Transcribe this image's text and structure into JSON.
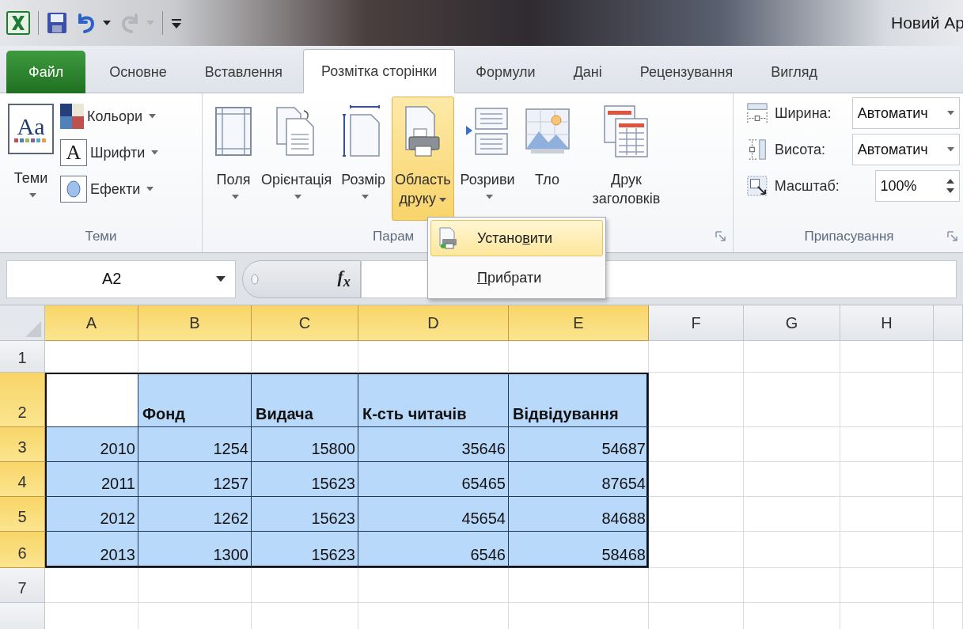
{
  "title_bar": {
    "title": "Новий Ар",
    "quick_access": [
      {
        "kind": "save",
        "has_menu": false
      },
      {
        "kind": "undo",
        "disabled": false,
        "has_menu": true
      },
      {
        "kind": "redo",
        "disabled": true,
        "has_menu": true
      },
      {
        "kind": "customize",
        "has_menu": false
      }
    ]
  },
  "tabs": [
    {
      "label": "Файл",
      "kind": "file",
      "selected": false
    },
    {
      "label": "Основне",
      "kind": "tab",
      "selected": false
    },
    {
      "label": "Вставлення",
      "kind": "tab",
      "selected": false
    },
    {
      "label": "Розмітка сторінки",
      "kind": "tab",
      "selected": true
    },
    {
      "label": "Формули",
      "kind": "tab",
      "selected": false
    },
    {
      "label": "Дані",
      "kind": "tab",
      "selected": false
    },
    {
      "label": "Рецензування",
      "kind": "tab",
      "selected": false
    },
    {
      "label": "Вигляд",
      "kind": "tab",
      "selected": false
    }
  ],
  "ribbon": {
    "themes_group": {
      "label": "Теми",
      "themes_button": {
        "label": "Теми",
        "icon_text": "Aa",
        "has_menu": true
      },
      "items": [
        {
          "label": "Кольори",
          "kind": "colors",
          "has_menu": true
        },
        {
          "label": "Шрифти",
          "kind": "fonts",
          "icon_text": "A",
          "has_menu": true
        },
        {
          "label": "Ефекти",
          "kind": "effects",
          "has_menu": true
        }
      ]
    },
    "page_setup_group": {
      "label": "Парам",
      "launcher": true,
      "buttons": [
        {
          "label": "Поля",
          "kind": "margins",
          "has_menu": true,
          "selected": false,
          "caret_inline": false
        },
        {
          "label": "Орієнтація",
          "kind": "orientation",
          "has_menu": true,
          "selected": false,
          "caret_inline": false
        },
        {
          "label": "Розмір",
          "kind": "size",
          "has_menu": true,
          "selected": false,
          "caret_inline": false
        },
        {
          "label": "Область\nдруку",
          "kind": "print_area",
          "has_menu": true,
          "selected": true,
          "caret_inline": true
        },
        {
          "label": "Розриви",
          "kind": "breaks",
          "has_menu": true,
          "selected": false,
          "caret_inline": false
        },
        {
          "label": "Тло",
          "kind": "background",
          "has_menu": false,
          "selected": false
        },
        {
          "label": "Друк\nзаголовків",
          "kind": "print_titles",
          "has_menu": false,
          "selected": false
        }
      ]
    },
    "fit_group": {
      "label": "Припасування",
      "launcher": true,
      "rows": [
        {
          "kind": "dropdown",
          "label": "Ширина:",
          "value": "Автоматич"
        },
        {
          "kind": "dropdown",
          "label": "Висота:",
          "value": "Автоматич"
        },
        {
          "kind": "spinner",
          "label": "Масштаб:",
          "value": "100%"
        }
      ]
    }
  },
  "formula_bar": {
    "name_box": "A2",
    "function_label": "f$_{x}$"
  },
  "menu": {
    "items": [
      {
        "has_icon": true,
        "selected": true,
        "parts": [
          {
            "text": "Устано",
            "underlined": false
          },
          {
            "text": "в",
            "underlined": true
          },
          {
            "text": "ити",
            "underlined": false
          }
        ]
      },
      {
        "has_icon": false,
        "selected": false,
        "parts": [
          {
            "text": "П",
            "underlined": true
          },
          {
            "text": "рибрати",
            "underlined": false
          }
        ]
      }
    ]
  },
  "sheet": {
    "columns": [
      {
        "label": "A",
        "selected": true
      },
      {
        "label": "B",
        "selected": true
      },
      {
        "label": "C",
        "selected": true
      },
      {
        "label": "D",
        "selected": true
      },
      {
        "label": "E",
        "selected": true
      },
      {
        "label": "F",
        "selected": false
      },
      {
        "label": "G",
        "selected": false
      },
      {
        "label": "H",
        "selected": false
      }
    ],
    "rows": [
      {
        "label": "1",
        "selected": false,
        "kind": "data"
      },
      {
        "label": "2",
        "selected": true,
        "kind": "header",
        "cells": [
          {
            "active": true
          },
          {
            "text": "Фонд",
            "active": false
          },
          {
            "text": "Видача",
            "active": false
          },
          {
            "text": "К-сть читачів",
            "active": false
          },
          {
            "text": "Відвідування",
            "active": false
          }
        ]
      },
      {
        "label": "3",
        "selected": true,
        "kind": "data",
        "cells": [
          {
            "text": "2010",
            "active": false
          },
          {
            "text": "1254",
            "active": false
          },
          {
            "text": "15800",
            "active": false
          },
          {
            "text": "35646",
            "active": false
          },
          {
            "text": "54687",
            "active": false
          }
        ]
      },
      {
        "label": "4",
        "selected": true,
        "kind": "data",
        "cells": [
          {
            "text": "2011",
            "active": false
          },
          {
            "text": "1257",
            "active": false
          },
          {
            "text": "15623",
            "active": false
          },
          {
            "text": "65465",
            "active": false
          },
          {
            "text": "87654",
            "active": false
          }
        ]
      },
      {
        "label": "5",
        "selected": true,
        "kind": "data",
        "cells": [
          {
            "text": "2012",
            "active": false
          },
          {
            "text": "1262",
            "active": false
          },
          {
            "text": "15623",
            "active": false
          },
          {
            "text": "45654",
            "active": false
          },
          {
            "text": "84688",
            "active": false
          }
        ]
      },
      {
        "label": "6",
        "selected": true,
        "kind": "data",
        "cells": [
          {
            "text": "2013",
            "active": false
          },
          {
            "text": "1300",
            "active": false
          },
          {
            "text": "15623",
            "active": false
          },
          {
            "text": "6546",
            "active": false
          },
          {
            "text": "58468",
            "active": false
          }
        ]
      },
      {
        "label": "7",
        "selected": false,
        "kind": "data"
      },
      {
        "selected": false,
        "kind": "data"
      }
    ]
  }
}
